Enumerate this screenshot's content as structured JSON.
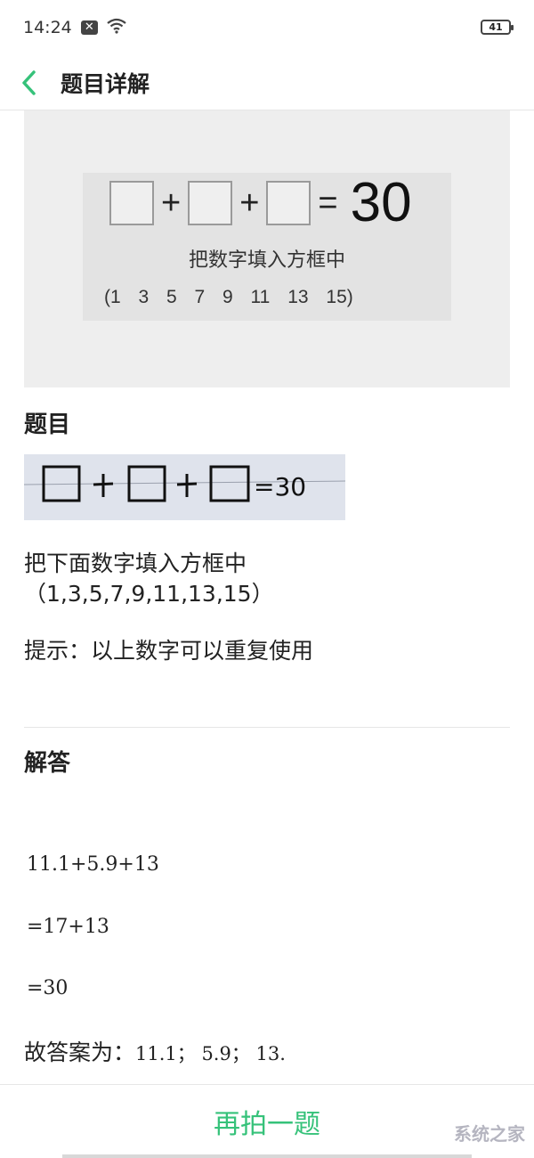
{
  "status_bar": {
    "time": "14:24",
    "notification_icon": "close-badge-icon",
    "wifi_icon": "wifi-icon",
    "battery": "41"
  },
  "header": {
    "back_icon": "chevron-left-icon",
    "title": "题目详解"
  },
  "hero_image": {
    "equation": {
      "plus": "+",
      "equals": "=",
      "result": "30"
    },
    "caption": "把数字填入方框中",
    "numbers": "(1 3 5 7 9 11 13 15)"
  },
  "question": {
    "title": "题目",
    "handwritten_equation": "=30",
    "line1": "把下面数字填入方框中",
    "line2": "（1,3,5,7,9,11,13,15）",
    "hint": "提示：以上数字可以重复使用"
  },
  "answer": {
    "title": "解答",
    "step1": "11.1+5.9+13",
    "step2": "=17+13",
    "step3": "=30",
    "conclusion_prefix": "故答案为：",
    "conclusion_values": "11.1； 5.9； 13."
  },
  "bottom": {
    "retake_label": "再拍一题"
  },
  "watermark": "系统之家",
  "colors": {
    "accent": "#36c27a",
    "text": "#222222",
    "divider": "#e6e6e6"
  }
}
